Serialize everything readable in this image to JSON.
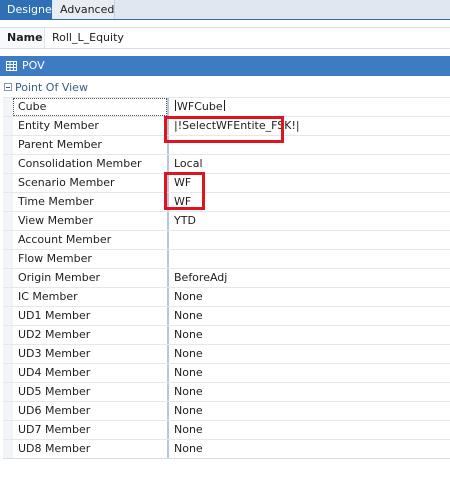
{
  "tabs": [
    {
      "label": "Designer",
      "active": true
    },
    {
      "label": "Advanced",
      "active": false
    }
  ],
  "name_field": {
    "label": "Name",
    "value": "Roll_L_Equity"
  },
  "section": {
    "title": "POV",
    "icon": "grid-icon"
  },
  "group": {
    "label": "Point Of View",
    "expanded": true
  },
  "properties": [
    {
      "label": "Cube",
      "value": "WFCube"
    },
    {
      "label": "Entity Member",
      "value": "|!SelectWFEntite_FSK!|"
    },
    {
      "label": "Parent Member",
      "value": ""
    },
    {
      "label": "Consolidation Member",
      "value": "Local"
    },
    {
      "label": "Scenario Member",
      "value": "WF"
    },
    {
      "label": "Time Member",
      "value": "WF"
    },
    {
      "label": "View Member",
      "value": "YTD"
    },
    {
      "label": "Account Member",
      "value": ""
    },
    {
      "label": "Flow Member",
      "value": ""
    },
    {
      "label": "Origin Member",
      "value": "BeforeAdj"
    },
    {
      "label": "IC Member",
      "value": "None"
    },
    {
      "label": "UD1 Member",
      "value": "None"
    },
    {
      "label": "UD2 Member",
      "value": "None"
    },
    {
      "label": "UD3 Member",
      "value": "None"
    },
    {
      "label": "UD4 Member",
      "value": "None"
    },
    {
      "label": "UD5 Member",
      "value": "None"
    },
    {
      "label": "UD6 Member",
      "value": "None"
    },
    {
      "label": "UD7 Member",
      "value": "None"
    },
    {
      "label": "UD8 Member",
      "value": "None"
    }
  ],
  "colors": {
    "accent": "#2f6fb3",
    "header": "#3d7cc2",
    "highlight": "#e0141e"
  }
}
